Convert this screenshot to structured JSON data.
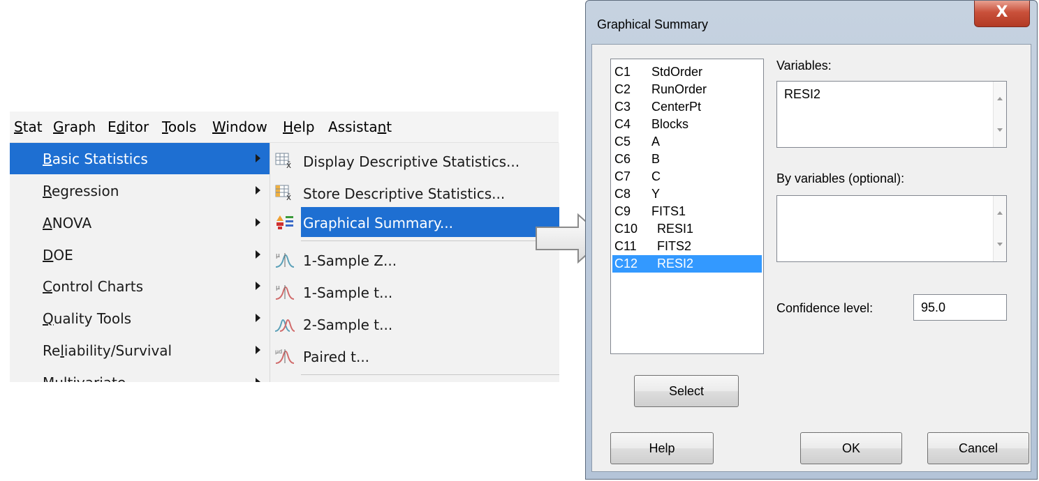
{
  "menubar": {
    "items": [
      {
        "pre": "",
        "ul": "S",
        "post": "tat"
      },
      {
        "pre": "",
        "ul": "G",
        "post": "raph"
      },
      {
        "pre": "E",
        "ul": "d",
        "post": "itor"
      },
      {
        "pre": "",
        "ul": "T",
        "post": "ools"
      },
      {
        "pre": "",
        "ul": "W",
        "post": "indow"
      },
      {
        "pre": "",
        "ul": "H",
        "post": "elp"
      },
      {
        "pre": "Assista",
        "ul": "n",
        "post": "t"
      }
    ]
  },
  "stat_menu": {
    "items": [
      {
        "pre": "",
        "ul": "B",
        "post": "asic Statistics",
        "highlighted": true
      },
      {
        "pre": "",
        "ul": "R",
        "post": "egression"
      },
      {
        "pre": "",
        "ul": "A",
        "post": "NOVA"
      },
      {
        "pre": "",
        "ul": "D",
        "post": "OE"
      },
      {
        "pre": "",
        "ul": "C",
        "post": "ontrol Charts"
      },
      {
        "pre": "",
        "ul": "Q",
        "post": "uality Tools"
      },
      {
        "pre": "Re",
        "ul": "l",
        "post": "iability/Survival"
      },
      {
        "pre": "Multivariate",
        "ul": "",
        "post": ""
      }
    ]
  },
  "basic_stats_menu": {
    "items": [
      {
        "pre": "",
        "ul": "D",
        "post": "isplay Descriptive Statistics...",
        "icon": "display-stats-icon"
      },
      {
        "pre": "",
        "ul": "S",
        "post": "tore Descriptive Statistics...",
        "icon": "store-stats-icon"
      },
      {
        "pre": "",
        "ul": "G",
        "post": "raphical Summary...",
        "icon": "graphical-summary-icon",
        "highlighted": true
      },
      {
        "pre": "1-Sample ",
        "ul": "Z",
        "post": "...",
        "icon": "one-sample-z-icon"
      },
      {
        "pre": "",
        "ul": "1",
        "post": "-Sample t...",
        "icon": "one-sample-t-icon"
      },
      {
        "pre": "",
        "ul": "2",
        "post": "-Sample t...",
        "icon": "two-sample-t-icon"
      },
      {
        "pre": "",
        "ul": "P",
        "post": "aired t...",
        "icon": "paired-t-icon"
      }
    ]
  },
  "dialog": {
    "title": "Graphical Summary",
    "close_glyph": "X",
    "columns": [
      {
        "col": "C1",
        "name": "StdOrder"
      },
      {
        "col": "C2",
        "name": "RunOrder"
      },
      {
        "col": "C3",
        "name": "CenterPt"
      },
      {
        "col": "C4",
        "name": "Blocks"
      },
      {
        "col": "C5",
        "name": "A"
      },
      {
        "col": "C6",
        "name": "B"
      },
      {
        "col": "C7",
        "name": "C"
      },
      {
        "col": "C8",
        "name": "Y"
      },
      {
        "col": "C9",
        "name": "FITS1"
      },
      {
        "col": "C10",
        "name": "RESI1"
      },
      {
        "col": "C11",
        "name": "FITS2"
      },
      {
        "col": "C12",
        "name": "RESI2",
        "selected": true
      }
    ],
    "variables_label": "Variables:",
    "variables_value": "RESI2",
    "by_variables_label": "By variables (optional):",
    "by_variables_value": "",
    "confidence_label": "Confidence level:",
    "confidence_value": "95.0",
    "select_label": "Select",
    "help_label": "Help",
    "ok_label": "OK",
    "cancel_label": "Cancel"
  },
  "colors": {
    "menu_highlight": "#1e6fd2",
    "list_selection": "#3399ff",
    "close_button": "#c9503a"
  }
}
